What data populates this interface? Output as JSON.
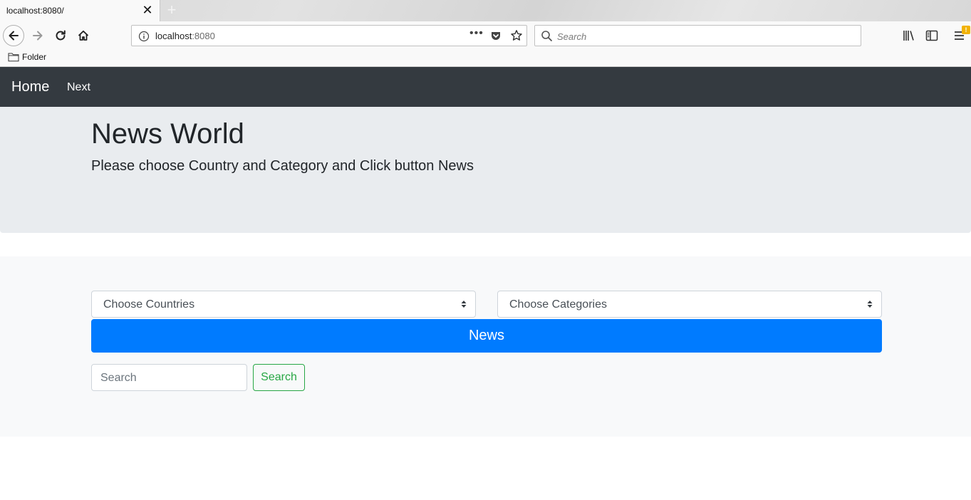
{
  "browser": {
    "tab_title": "localhost:8080/",
    "tab_close": "✕",
    "new_tab": "+",
    "url_host": "localhost",
    "url_port": ":8080",
    "more_dots": "•••",
    "search_placeholder": "Search",
    "menu_badge": "!",
    "bookmark_folder_label": "Folder"
  },
  "site_nav": {
    "brand": "Home",
    "next_link": "Next"
  },
  "jumbotron": {
    "title": "News World",
    "lead": "Please choose Country and Category and Click button News"
  },
  "form": {
    "country_select": "Choose Countries",
    "category_select": "Choose Categories",
    "news_button": "News",
    "search_placeholder": "Search",
    "search_button": "Search"
  },
  "colors": {
    "navbar": "#343a40",
    "jumbotron": "#e9ecef",
    "panel": "#f8f9fa",
    "primary": "#007bff",
    "success": "#28a745"
  },
  "icons": [
    "back-arrow-icon",
    "forward-arrow-icon",
    "reload-icon",
    "home-icon",
    "info-icon",
    "pocket-icon",
    "star-icon",
    "search-icon",
    "library-icon",
    "sidebar-icon",
    "hamburger-menu-icon",
    "folder-icon",
    "select-caret-icon"
  ]
}
